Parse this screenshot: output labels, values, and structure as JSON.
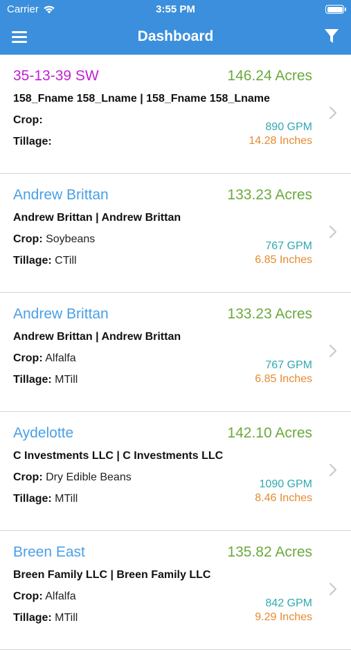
{
  "status_bar": {
    "carrier": "Carrier",
    "time": "3:55 PM"
  },
  "header": {
    "title": "Dashboard",
    "menu_icon": "hamburger-menu-icon",
    "filter_icon": "filter-funnel-icon"
  },
  "colors": {
    "header_bg": "#3c8fdc",
    "acres": "#6aaa3c",
    "gpm": "#2fa9b1",
    "inches": "#e58a2f",
    "name_default": "#4a9fe6",
    "name_highlight": "#c31ed6"
  },
  "fields": [
    {
      "name": "35-13-39 SW",
      "name_color": "#c31ed6",
      "acres": "146.24 Acres",
      "owners": "158_Fname 158_Lname  |  158_Fname 158_Lname",
      "crop_label": "Crop:",
      "crop": "",
      "tillage_label": "Tillage:",
      "tillage": "",
      "gpm": "890 GPM",
      "inches": "14.28 Inches"
    },
    {
      "name": "Andrew Brittan",
      "name_color": "#4a9fe6",
      "acres": "133.23 Acres",
      "owners": "Andrew Brittan  |  Andrew Brittan",
      "crop_label": "Crop:",
      "crop": "Soybeans",
      "tillage_label": "Tillage:",
      "tillage": "CTill",
      "gpm": "767 GPM",
      "inches": "6.85 Inches"
    },
    {
      "name": "Andrew Brittan",
      "name_color": "#4a9fe6",
      "acres": "133.23 Acres",
      "owners": "Andrew Brittan  |  Andrew Brittan",
      "crop_label": "Crop:",
      "crop": "Alfalfa",
      "tillage_label": "Tillage:",
      "tillage": "MTill",
      "gpm": "767 GPM",
      "inches": "6.85 Inches"
    },
    {
      "name": "Aydelotte",
      "name_color": "#4a9fe6",
      "acres": "142.10 Acres",
      "owners": "C Investments LLC  |  C Investments LLC",
      "crop_label": "Crop:",
      "crop": "Dry Edible Beans",
      "tillage_label": "Tillage:",
      "tillage": "MTill",
      "gpm": "1090 GPM",
      "inches": "8.46 Inches"
    },
    {
      "name": "Breen East",
      "name_color": "#4a9fe6",
      "acres": "135.82 Acres",
      "owners": "Breen Family LLC  |  Breen Family LLC",
      "crop_label": "Crop:",
      "crop": "Alfalfa",
      "tillage_label": "Tillage:",
      "tillage": "MTill",
      "gpm": "842 GPM",
      "inches": "9.29 Inches"
    }
  ]
}
